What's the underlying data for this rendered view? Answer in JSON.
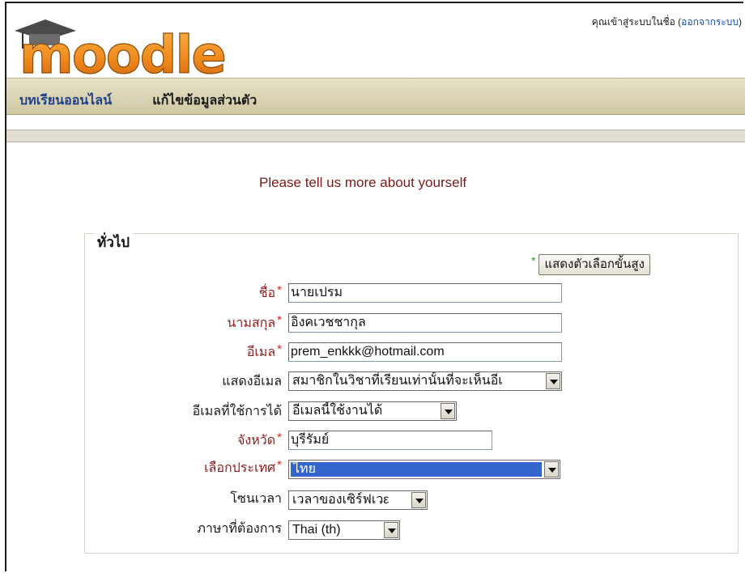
{
  "header": {
    "logo_text": "moodle",
    "login_text": "คุณเข้าสู่ระบบในชื่อ (",
    "logout_link": "ออกจากระบบ",
    "login_close": ")"
  },
  "breadcrumb": {
    "home": "บทเรียนออนไลน์",
    "separator": "► ►",
    "current": "แก้ไขข้อมูลส่วนตัว"
  },
  "form": {
    "intro": "Please tell us more about yourself",
    "legend": "ทั่วไป",
    "advanced_button": "แสดงตัวเลือกขั้นสูง",
    "advanced_star": "*",
    "required_star": "*",
    "fields": {
      "firstname": {
        "label": "ชื่อ",
        "value": "นายเปรม"
      },
      "lastname": {
        "label": "นามสกุล",
        "value": "อิงคเวชชากุล"
      },
      "email": {
        "label": "อีเมล",
        "value": "prem_enkkk@hotmail.com"
      },
      "maildisplay": {
        "label": "แสดงอีเมล",
        "value": "สมาชิกในวิชาที่เรียนเท่านั้นที่จะเห็นอีเ"
      },
      "emailstop": {
        "label": "อีเมลที่ใช้การได้",
        "value": "อีเมลนี้ใช้งานได้"
      },
      "city": {
        "label": "จังหวัด",
        "value": "บุรีรัมย์"
      },
      "country": {
        "label": "เลือกประเทศ",
        "value": "ไทย"
      },
      "timezone": {
        "label": "โซนเวลา",
        "value": "เวลาของเซิร์ฟเวε"
      },
      "lang": {
        "label": "ภาษาที่ต้องการ",
        "value": "Thai (th)"
      }
    }
  },
  "colors": {
    "navbar": "#d9d3b3",
    "required_label": "#8b1e1e",
    "star": "#e0221b",
    "link": "#1e3f8a",
    "selection": "#3366cc"
  }
}
